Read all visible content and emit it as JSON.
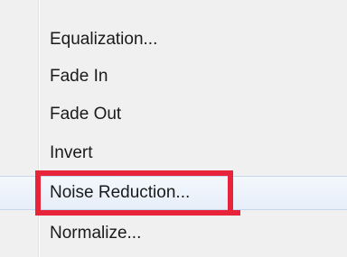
{
  "menu": {
    "items": [
      {
        "label": "Equalization...",
        "hovered": false
      },
      {
        "label": "Fade In",
        "hovered": false
      },
      {
        "label": "Fade Out",
        "hovered": false
      },
      {
        "label": "Invert",
        "hovered": false
      },
      {
        "label": "Noise Reduction...",
        "hovered": true
      },
      {
        "label": "Normalize...",
        "hovered": false
      }
    ]
  },
  "colors": {
    "background": "#f0f0f0",
    "hover_background": "#e6eef9",
    "hover_border": "#c6d6ec",
    "annotation": "#e8243b",
    "text": "#1a1a1a"
  }
}
